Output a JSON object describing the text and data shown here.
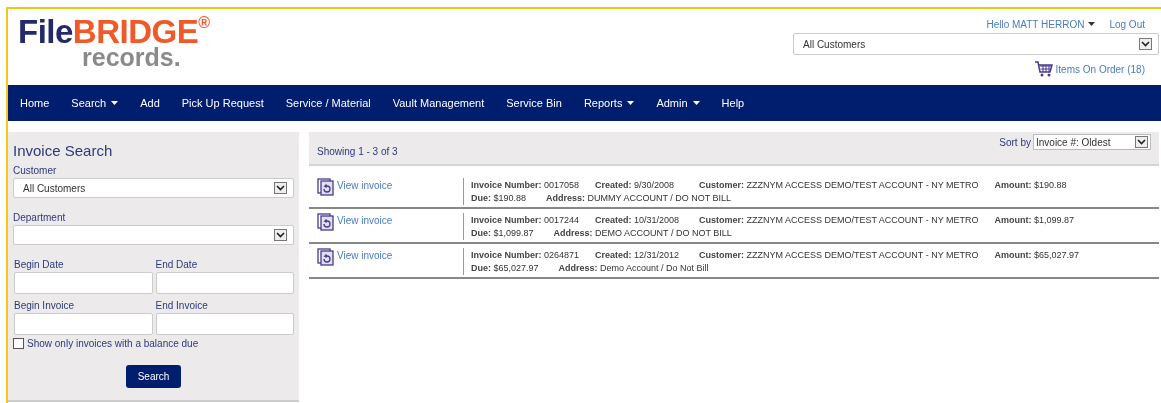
{
  "logo": {
    "file": "File",
    "bridge": "BRIDGE",
    "reg": "®",
    "records": "records."
  },
  "user_menu": {
    "greeting": "Hello MATT HERRON",
    "logout": "Log Out"
  },
  "customer_select": {
    "value": "All Customers"
  },
  "cart": {
    "label": "Items On Order (18)"
  },
  "nav": [
    {
      "label": "Home",
      "dropdown": false
    },
    {
      "label": "Search",
      "dropdown": true
    },
    {
      "label": "Add",
      "dropdown": false
    },
    {
      "label": "Pick Up Request",
      "dropdown": false
    },
    {
      "label": "Service / Material",
      "dropdown": false
    },
    {
      "label": "Vault Management",
      "dropdown": false
    },
    {
      "label": "Service Bin",
      "dropdown": false
    },
    {
      "label": "Reports",
      "dropdown": true
    },
    {
      "label": "Admin",
      "dropdown": true
    },
    {
      "label": "Help",
      "dropdown": false
    }
  ],
  "search_panel": {
    "title": "Invoice Search",
    "customer_label": "Customer",
    "customer_value": "All Customers",
    "department_label": "Department",
    "begin_date_label": "Begin Date",
    "end_date_label": "End Date",
    "begin_invoice_label": "Begin Invoice",
    "end_invoice_label": "End Invoice",
    "balance_checkbox": {
      "label": "Show only invoices with a balance due",
      "checked": false
    },
    "button": "Search"
  },
  "results": {
    "showing": "Showing 1 - 3 of 3",
    "sort_label": "Sort by",
    "sort_value": "Invoice #: Oldest",
    "rows": [
      {
        "link": "View invoice",
        "line1": [
          {
            "label": "Invoice Number:",
            "value": "0017058"
          },
          {
            "label": "Created:",
            "value": "9/30/2008"
          },
          {
            "label": "Customer:",
            "value": "ZZZNYM ACCESS DEMO/TEST ACCOUNT - NY METRO"
          },
          {
            "label": "Amount:",
            "value": "$190.88"
          }
        ],
        "line2": [
          {
            "label": "Due:",
            "value": "$190.88"
          },
          {
            "label": "Address:",
            "value": "DUMMY ACCOUNT / DO NOT BILL"
          }
        ]
      },
      {
        "link": "View invoice",
        "line1": [
          {
            "label": "Invoice Number:",
            "value": "0017244"
          },
          {
            "label": "Created:",
            "value": "10/31/2008"
          },
          {
            "label": "Customer:",
            "value": "ZZZNYM ACCESS DEMO/TEST ACCOUNT - NY METRO"
          },
          {
            "label": "Amount:",
            "value": "$1,099.87"
          }
        ],
        "line2": [
          {
            "label": "Due:",
            "value": "$1,099.87"
          },
          {
            "label": "Address:",
            "value": "DEMO ACCOUNT / DO NOT BILL"
          }
        ]
      },
      {
        "link": "View invoice",
        "line1": [
          {
            "label": "Invoice Number:",
            "value": "0264871"
          },
          {
            "label": "Created:",
            "value": "12/31/2012"
          },
          {
            "label": "Customer:",
            "value": "ZZZNYM ACCESS DEMO/TEST ACCOUNT - NY METRO"
          },
          {
            "label": "Amount:",
            "value": "$65,027.97"
          }
        ],
        "line2": [
          {
            "label": "Due:",
            "value": "$65,027.97"
          },
          {
            "label": "Address:",
            "value": "Demo Account / Do Not Bill"
          }
        ]
      }
    ]
  }
}
